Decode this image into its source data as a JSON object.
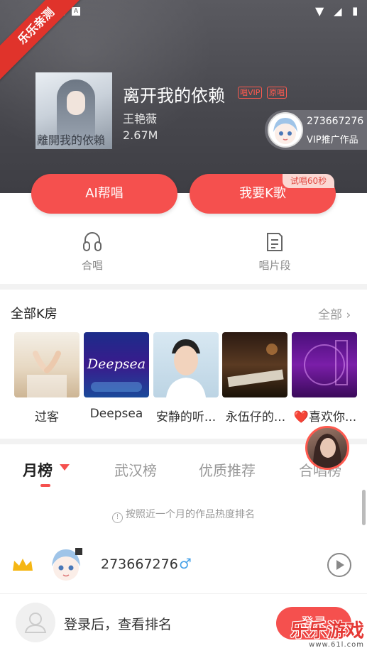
{
  "corner_ribbon": "乐乐亲测",
  "song": {
    "title": "离开我的依赖",
    "tag_vip": "唱VIP",
    "tag_orig": "原唱",
    "singer": "王艳薇",
    "plays": "2.67M",
    "cover_text": "離開我的依賴"
  },
  "promo": {
    "id": "273667276",
    "label": "VIP推广作品"
  },
  "buttons": {
    "ai_sing": "AI帮唱",
    "karaoke": "我要K歌",
    "trial": "试唱60秒"
  },
  "functions": [
    {
      "label": "合唱"
    },
    {
      "label": "唱片段"
    }
  ],
  "rooms": {
    "title": "全部K房",
    "all_label": "全部",
    "items": [
      {
        "name": "过客"
      },
      {
        "name": "Deepsea",
        "art_text": "Deepsea"
      },
      {
        "name": "安静的听..."
      },
      {
        "name": "永伍仔的..."
      },
      {
        "name": "❤️喜欢你..."
      }
    ]
  },
  "tabs": [
    "月榜",
    "武汉榜",
    "优质推荐",
    "合唱榜"
  ],
  "ranking_note": "按照近一个月的作品热度排名",
  "rank_row": {
    "name": "273667276",
    "gender_symbol": "♂"
  },
  "login_bar": {
    "prompt": "登录后，查看排名",
    "button": "登录"
  },
  "watermark": {
    "main": "乐乐游戏",
    "url": "www.61l.com"
  },
  "colors": {
    "accent": "#f5504e",
    "hero": "#4a4a50"
  }
}
